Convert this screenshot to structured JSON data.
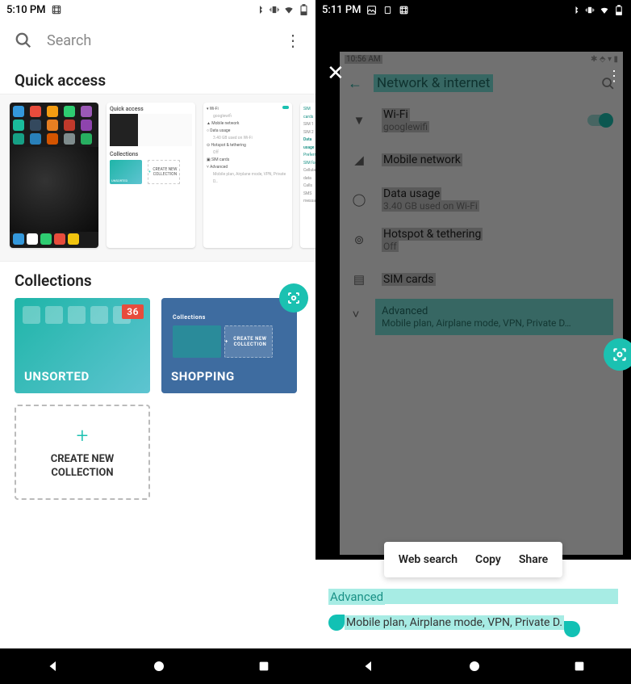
{
  "left": {
    "status": {
      "time": "5:10 PM"
    },
    "search": {
      "placeholder": "Search"
    },
    "quick_access": {
      "title": "Quick access",
      "card2": {
        "h1": "Quick access",
        "h2": "Collections",
        "unsorted": "UNSORTED",
        "create": "CREATE NEW COLLECTION"
      },
      "card3": {
        "items": [
          "Wi-Fi",
          "Mobile network",
          "Data usage",
          "Hotspot & tethering",
          "SIM cards",
          "Advanced"
        ],
        "sub_wifi": "googlewifi",
        "sub_data": "3.40 GB used on Wi-Fi",
        "sub_hotspot": "Off",
        "sub_adv": "Mobile plan, Airplane mode, VPN, Private D…"
      },
      "card4": {
        "items": [
          "SIM cards",
          "SIM 1",
          "SIM 2",
          "Data usage",
          "Preferred SIM for",
          "Cellular data",
          "Calls",
          "SMS messages"
        ]
      }
    },
    "collections": {
      "title": "Collections",
      "unsorted": {
        "label": "UNSORTED",
        "badge": "36"
      },
      "shopping": {
        "label": "SHOPPING",
        "mini_h": "Collections",
        "mini_create": "CREATE NEW COLLECTION"
      },
      "create": {
        "label": "CREATE NEW\nCOLLECTION"
      }
    }
  },
  "right": {
    "status": {
      "time": "5:11 PM"
    },
    "shot_status_time": "10:56 AM",
    "settings": {
      "title": "Network & internet",
      "wifi": {
        "label": "Wi-Fi",
        "sub": "googlewifi"
      },
      "mobile": {
        "label": "Mobile network"
      },
      "data": {
        "label": "Data usage",
        "sub": "3.40 GB used on Wi-Fi"
      },
      "hotspot": {
        "label": "Hotspot & tethering",
        "sub": "Off"
      },
      "sim": {
        "label": "SIM cards"
      },
      "advanced": {
        "label": "Advanced",
        "sub": "Mobile plan, Airplane mode, VPN, Private D…"
      }
    },
    "context": {
      "search": "Web search",
      "copy": "Copy",
      "share": "Share"
    },
    "sheet": {
      "title": "Advanced",
      "sub": "Mobile plan, Airplane mode, VPN, Private D."
    }
  }
}
